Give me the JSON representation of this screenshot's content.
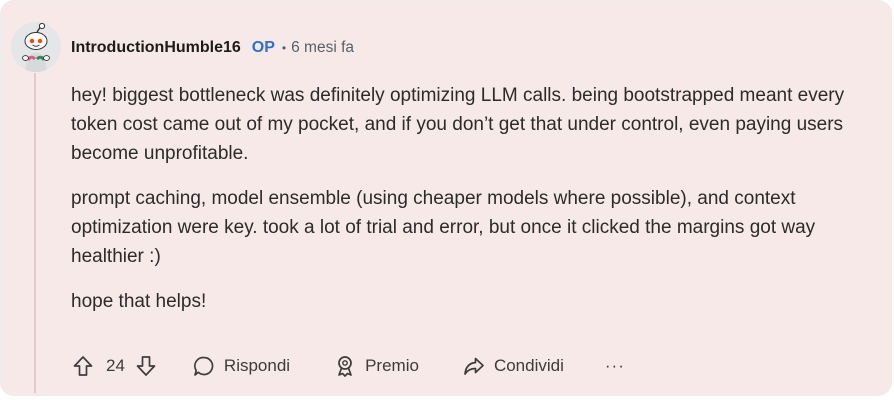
{
  "comment": {
    "author": "IntroductionHumble16",
    "badge": "OP",
    "separator": "•",
    "timestamp": "6 mesi fa",
    "paragraphs": [
      "hey! biggest bottleneck was definitely optimizing LLM calls. being bootstrapped meant every token cost came out of my pocket, and if you don’t get that under control, even paying users become unprofitable.",
      "prompt caching, model ensemble (using cheaper models where possible), and context optimization were key. took a lot of trial and error, but once it clicked the margins got way healthier :)",
      "hope that helps!"
    ]
  },
  "actions": {
    "vote_count": "24",
    "reply_label": "Rispondi",
    "award_label": "Premio",
    "share_label": "Condividi",
    "more_label": "···"
  },
  "colors": {
    "card_background": "#f7e9e8",
    "op_badge": "#2a6fdc",
    "thread_line": "#e6c8c6"
  },
  "icons": [
    "snoo-avatar",
    "upvote-icon",
    "downvote-icon",
    "comment-bubble-icon",
    "award-icon",
    "share-icon",
    "more-icon"
  ]
}
